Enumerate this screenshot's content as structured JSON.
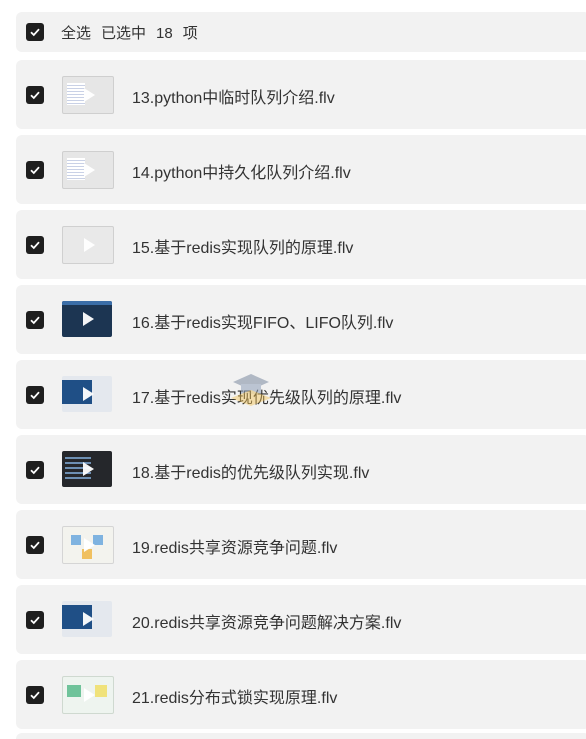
{
  "header": {
    "select_all": "全选",
    "selected": "已选中",
    "count": "18",
    "unit": "项"
  },
  "files": [
    {
      "title": "13.python中临时队列介绍.flv",
      "thumb": "light"
    },
    {
      "title": "14.python中持久化队列介绍.flv",
      "thumb": "light"
    },
    {
      "title": "15.基于redis实现队列的原理.flv",
      "thumb": "blank"
    },
    {
      "title": "16.基于redis实现FIFO、LIFO队列.flv",
      "thumb": "dark"
    },
    {
      "title": "17.基于redis实现优先级队列的原理.flv",
      "thumb": "mix"
    },
    {
      "title": "18.基于redis的优先级队列实现.flv",
      "thumb": "code"
    },
    {
      "title": "19.redis共享资源竞争问题.flv",
      "thumb": "diagram"
    },
    {
      "title": "20.redis共享资源竞争问题解决方案.flv",
      "thumb": "mix"
    },
    {
      "title": "21.redis分布式锁实现原理.flv",
      "thumb": "green"
    }
  ],
  "colors": {
    "row_bg": "#f2f2f2",
    "checkbox": "#1f1f1f"
  }
}
